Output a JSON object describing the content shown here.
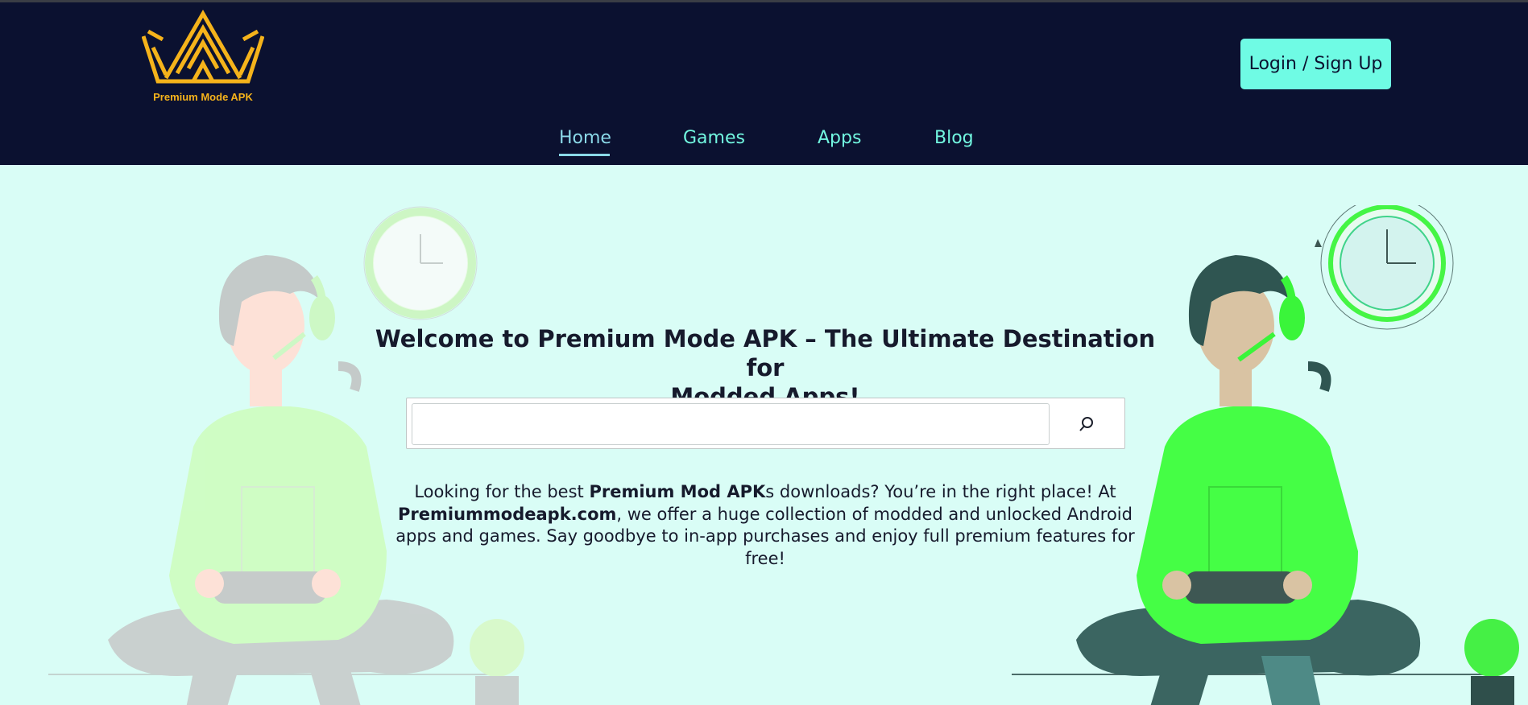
{
  "brand": {
    "name": "Premium Mode APK",
    "logo_icon": "crown-logo-icon",
    "logo_color": "#f5b31b"
  },
  "header": {
    "login_label": "Login / Sign Up",
    "bg": "#0b1130",
    "accent": "#6ffbe4"
  },
  "nav": {
    "items": [
      {
        "label": "Home",
        "active": true
      },
      {
        "label": "Games",
        "active": false
      },
      {
        "label": "Apps",
        "active": false
      },
      {
        "label": "Blog",
        "active": false
      }
    ]
  },
  "hero": {
    "title_line1": "Welcome to Premium Mode APK – The Ultimate Destination for",
    "title_line2": "Modded Apps!",
    "search": {
      "value": "",
      "placeholder": "",
      "icon": "search-icon"
    },
    "desc": {
      "p1": "Looking for the best ",
      "b1": "Premium Mod APK",
      "p2": "s downloads? You’re in the right place! At ",
      "b2": "Premiummodeapk.com",
      "p3": ", we offer a huge collection of modded and unlocked Android apps and games. Say goodbye to in-app purchases and enjoy full premium features for free!"
    }
  }
}
